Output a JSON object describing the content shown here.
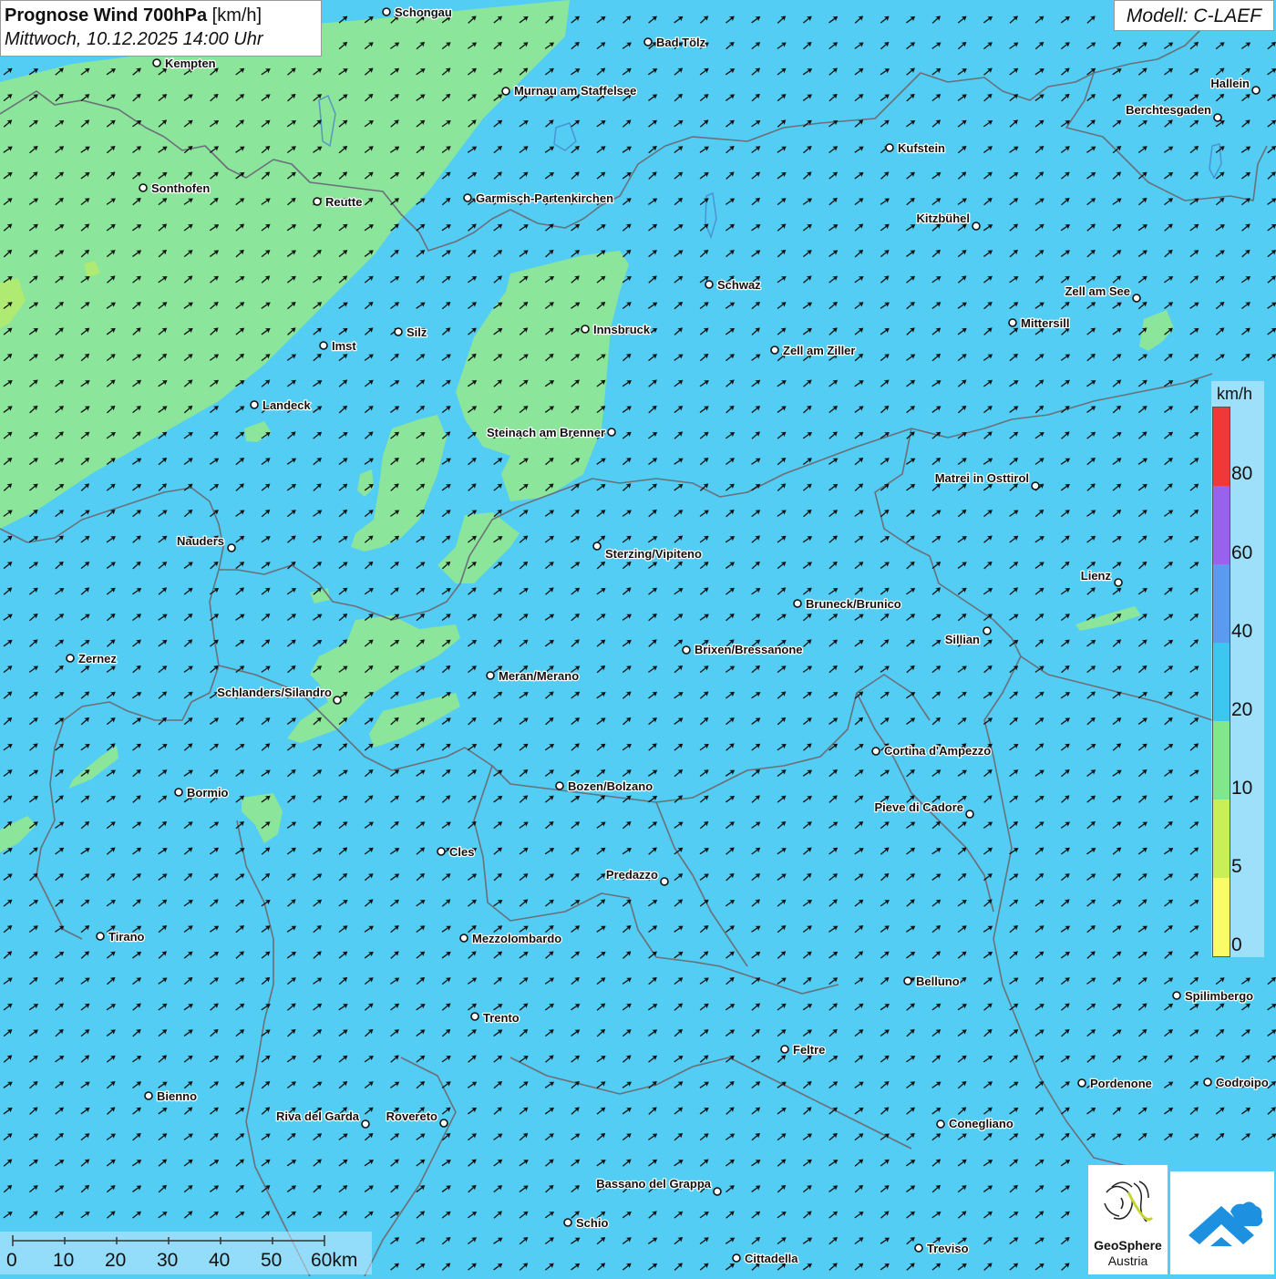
{
  "title": {
    "product_bold": "Prognose Wind 700hPa",
    "unit": "[km/h]",
    "datetime": "Mittwoch, 10.12.2025 14:00 Uhr"
  },
  "model_label": "Modell: C-LAEF",
  "legend": {
    "unit": "km/h",
    "ticks": [
      "80",
      "60",
      "40",
      "20",
      "10",
      "5",
      "0"
    ],
    "classes": [
      {
        "range": "80+",
        "color": "#f03838"
      },
      {
        "range": "60-80",
        "color": "#9a60ee"
      },
      {
        "range": "40-60",
        "color": "#5a9af0"
      },
      {
        "range": "20-40",
        "color": "#3cc6f0"
      },
      {
        "range": "10-20",
        "color": "#80e88a"
      },
      {
        "range": "5-10",
        "color": "#c8ee58"
      },
      {
        "range": "0-5",
        "color": "#fbfb6a"
      }
    ]
  },
  "colors": {
    "background_wind": "#53cdf3",
    "low_wind": "#8be59a",
    "border": "#6b6f7a",
    "arrow": "#111111"
  },
  "wind": {
    "general_direction": "from south-west",
    "arrow_icon": "wind-arrow-icon"
  },
  "cities": [
    {
      "id": "schongau",
      "name": "Schongau"
    },
    {
      "id": "bad-toelz",
      "name": "Bad Tölz"
    },
    {
      "id": "kempten",
      "name": "Kempten"
    },
    {
      "id": "murnau",
      "name": "Murnau am Staffelsee"
    },
    {
      "id": "hallein",
      "name": "Hallein"
    },
    {
      "id": "berchtesgaden",
      "name": "Berchtesgaden"
    },
    {
      "id": "kufstein",
      "name": "Kufstein"
    },
    {
      "id": "sonthofen",
      "name": "Sonthofen"
    },
    {
      "id": "reutte",
      "name": "Reutte"
    },
    {
      "id": "garmisch",
      "name": "Garmisch-Partenkirchen"
    },
    {
      "id": "kitzbuehel",
      "name": "Kitzbühel"
    },
    {
      "id": "schwaz",
      "name": "Schwaz"
    },
    {
      "id": "zell-am-see",
      "name": "Zell am See"
    },
    {
      "id": "innsbruck",
      "name": "Innsbruck"
    },
    {
      "id": "mittersill",
      "name": "Mittersill"
    },
    {
      "id": "silz",
      "name": "Silz"
    },
    {
      "id": "imst",
      "name": "Imst"
    },
    {
      "id": "zell-am-ziller",
      "name": "Zell am Ziller"
    },
    {
      "id": "landeck",
      "name": "Landeck"
    },
    {
      "id": "steinach",
      "name": "Steinach am Brenner"
    },
    {
      "id": "matrei",
      "name": "Matrei in Osttirol"
    },
    {
      "id": "nauders",
      "name": "Nauders"
    },
    {
      "id": "sterzing",
      "name": "Sterzing/Vipiteno"
    },
    {
      "id": "lienz",
      "name": "Lienz"
    },
    {
      "id": "bruneck",
      "name": "Bruneck/Brunico"
    },
    {
      "id": "sillian",
      "name": "Sillian"
    },
    {
      "id": "brixen",
      "name": "Brixen/Bressanone"
    },
    {
      "id": "zernez",
      "name": "Zernez"
    },
    {
      "id": "meran",
      "name": "Meran/Merano"
    },
    {
      "id": "schlanders",
      "name": "Schlanders/Silandro"
    },
    {
      "id": "cortina",
      "name": "Cortina d'Ampezzo"
    },
    {
      "id": "bozen",
      "name": "Bozen/Bolzano"
    },
    {
      "id": "bormio",
      "name": "Bormio"
    },
    {
      "id": "pieve",
      "name": "Pieve di Cadore"
    },
    {
      "id": "cles",
      "name": "Cles"
    },
    {
      "id": "predazzo",
      "name": "Predazzo"
    },
    {
      "id": "tirano",
      "name": "Tirano"
    },
    {
      "id": "mezzolombardo",
      "name": "Mezzolombardo"
    },
    {
      "id": "belluno",
      "name": "Belluno"
    },
    {
      "id": "spilimbergo",
      "name": "Spilimbergo"
    },
    {
      "id": "trento",
      "name": "Trento"
    },
    {
      "id": "feltre",
      "name": "Feltre"
    },
    {
      "id": "pordenone",
      "name": "Pordenone"
    },
    {
      "id": "codroipo",
      "name": "Codroipo"
    },
    {
      "id": "bienno",
      "name": "Bienno"
    },
    {
      "id": "riva",
      "name": "Riva del Garda"
    },
    {
      "id": "rovereto",
      "name": "Rovereto"
    },
    {
      "id": "conegliano",
      "name": "Conegliano"
    },
    {
      "id": "bassano",
      "name": "Bassano del Grappa"
    },
    {
      "id": "schio",
      "name": "Schio"
    },
    {
      "id": "treviso",
      "name": "Treviso"
    },
    {
      "id": "cittadella",
      "name": "Cittadella"
    }
  ],
  "scale_bar": {
    "labels": [
      "0",
      "10",
      "20",
      "30",
      "40",
      "50",
      "60km"
    ]
  },
  "logos": {
    "geosphere_line1": "GeoSphere",
    "geosphere_line2": "Austria"
  }
}
